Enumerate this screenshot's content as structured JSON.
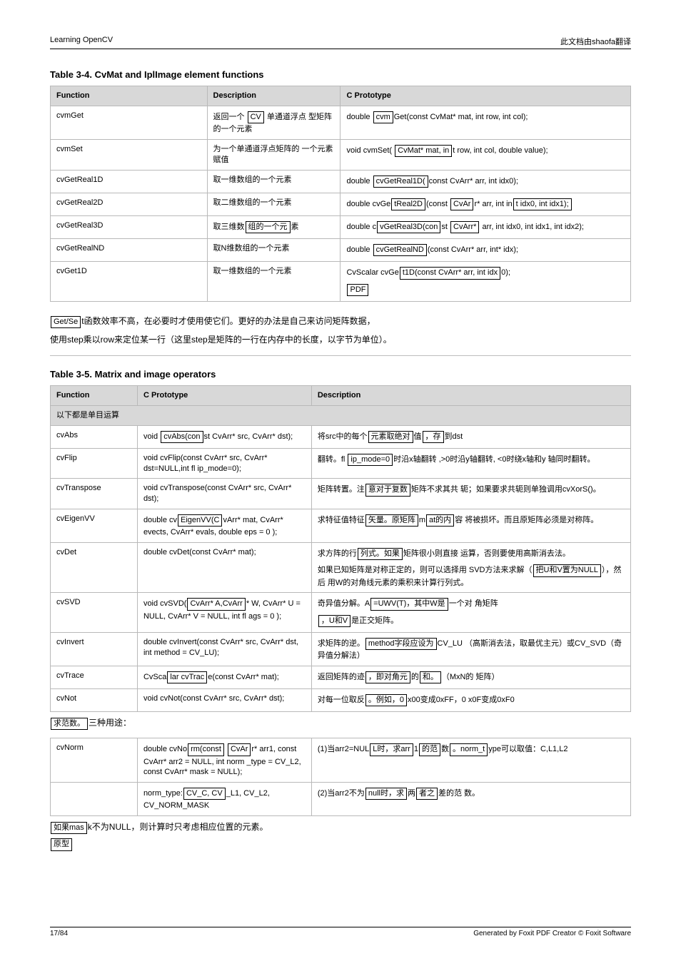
{
  "header": {
    "left": "Learning OpenCV",
    "right": "此文档由shaofa翻译"
  },
  "sections": {
    "table1_title": "Table 3-4. CvMat and IplImage element functions",
    "table1": {
      "headers": [
        "Function",
        "Description",
        "C Prototype"
      ],
      "rows": [
        {
          "func": "cvmGet",
          "desc_pre": "返回一个 ",
          "desc_box": "CV",
          "desc_post": " 单通道浮点 型矩阵的一个元素",
          "proto": [
            {
              "pre": "double ",
              "box": "cvm",
              "post": "Get(const CvMat* mat, int row, int col);"
            }
          ]
        },
        {
          "func": "cvmSet",
          "desc": "为一个单通道浮点矩阵的 一个元素赋值",
          "proto": [
            {
              "pre": "void cvmSet( ",
              "box": "CvMat* mat, in",
              "post": "t row, int col, double value);"
            }
          ]
        },
        {
          "func": "cvGetReal1D",
          "desc": "取一维数组的一个元素",
          "proto": [
            {
              "pre": "double ",
              "box": "cvGetReal1D(",
              "post": "const CvArr* arr, int idx0);"
            }
          ]
        },
        {
          "func": "cvGetReal2D",
          "desc": "取二维数组的一个元素",
          "proto": [
            {
              "pre": "double cvGe",
              "box1": "tReal2D",
              "mid": "(const ",
              "box2": "CvAr",
              "post": "r* arr, int in",
              "box3": "t idx0, int idx1);"
            }
          ]
        },
        {
          "func": "cvGetReal3D",
          "desc_pre": "取三维数",
          "desc_box": "组的一个元",
          "desc_post": "素",
          "proto": [
            {
              "pre": "double c",
              "box1": "vGetReal3D(con",
              "mid": "st ",
              "box2": "CvArr*",
              "post": " arr, int idx0, int idx1, int idx2);"
            }
          ]
        },
        {
          "func": "cvGetRealND",
          "desc": "取N维数组的一个元素",
          "proto": [
            {
              "pre": "double ",
              "box": "cvGetRealND",
              "post": "(const CvArr* arr, int* idx);"
            }
          ]
        },
        {
          "func": "cvGet1D",
          "desc": "取一维数组的一个元素",
          "proto": [
            {
              "pre": "CvScalar cvGe",
              "box1": "t1D(const CvArr* arr, int idx",
              "post": "0);",
              "box2": "PDF"
            }
          ]
        }
      ]
    },
    "note_pre": "",
    "note_box": "Get/Se",
    "note_post": "t函数效率不高，在必要时才使用使它们。更好的办法是自己来访问矩阵数据，",
    "note_line2": "使用step乘以row来定位某一行（这里step是矩阵的一行在内存中的长度，以字节为单位）。",
    "table2_title": "Table 3-5. Matrix and image operators",
    "table2": {
      "headers": [
        "Function",
        "C Prototype",
        "Description"
      ],
      "intro": "以下都是单目运算",
      "rows": [
        {
          "func": "cvAbs",
          "proto_pre": "void ",
          "proto_box": "cvAbs(con",
          "proto_post": "st CvArr* src, CvArr* dst);",
          "desc_pre": "将src中的每个",
          "desc_box1": "元素取绝对",
          "desc_mid": "值",
          "desc_box2": "，存",
          "desc_post": "到dst"
        },
        {
          "func": "cvFlip",
          "proto": "void cvFlip(const CvArr* src, CvArr* dst=NULL,int fl ip_mode=0);",
          "desc_pre": "翻转。fl ",
          "desc_box": "ip_mode=0",
          "desc_post": "时沿x轴翻转 ,>0时沿y轴翻转, <0时绕x轴和y 轴同时翻转。"
        },
        {
          "func": "cvTranspose",
          "proto": "void cvTranspose(const CvArr* src, CvArr* dst);",
          "desc_pre": "矩阵转置。注",
          "desc_box": "意对于复数",
          "desc_post": "矩阵不求其共 轭；如果要求共轭则单独调用cvXorS()。"
        },
        {
          "func": "cvEigenVV",
          "proto_pre": "double cv",
          "proto_box": "EigenVV(C",
          "proto_post": "vArr* mat, CvArr* evects, CvArr* evals, double eps = 0 );",
          "desc_pre": "求特征值特征",
          "desc_box1": "矢量。原矩阵",
          "desc_mid": "m",
          "desc_box2": "at的内",
          "desc_post": "容 将被损坏。而且原矩阵必须是对称阵。"
        },
        {
          "func": "cvDet",
          "proto": "double cvDet(const CvArr* mat);",
          "desc_pre": "求方阵的行",
          "desc_box": "列式。如果",
          "desc_post": "矩阵很小则直接 运算，否则要使用高斯消去法。",
          "desc_line2_pre": "如果已知矩阵是对称正定的，则可以选择用 SVD方法来求解（",
          "desc_line2_box": "把U和V置为NULL",
          "desc_post2": "），然后 用W的对角线元素的乘积来计算行列式。"
        },
        {
          "func": "cvSVD",
          "proto_pre": "void cvSVD(",
          "proto_box": "CvArr* A,CvArr",
          "proto_post": "* W, CvArr* U = NULL, CvArr* V = NULL, int fl ags = 0 );",
          "desc_pre": "奇异值分解。A",
          "desc_box": "=UWV(T)，其中W是",
          "desc_post": "一个对 角矩阵",
          "desc_box2": "，U和V",
          "desc_post2": "是正交矩阵。"
        },
        {
          "func": "cvInvert",
          "proto": "double cvInvert(const CvArr* src, CvArr* dst, int method = CV_LU);",
          "desc_pre": "求矩阵的逆。",
          "desc_box": "method字段应设为",
          "desc_post": "CV_LU （高斯消去法，取最优主元）或CV_SVD（奇 异值分解法）"
        },
        {
          "func": "cvTrace",
          "proto_pre": "CvSca",
          "proto_box": "lar cvTrac",
          "proto_post": "e(const CvArr* mat);",
          "desc_pre": "返回矩阵的迹",
          "desc_box1": "，即对角元",
          "desc_mid": "的",
          "desc_box2": "和。",
          "desc_post": "（MxN的 矩阵）"
        },
        {
          "func": "cvNot",
          "proto": "void cvNot(const CvArr* src, CvArr* dst);",
          "desc_pre": "对每一位取反",
          "desc_box": "。例如，0",
          "desc_post": "x00变成0xFF，0 x0F变成0xF0"
        }
      ]
    },
    "table3": {
      "intro_box": "求范数。",
      "intro_post": "三种用途：",
      "rows": [
        {
          "func": "cvNorm",
          "proto_pre": "double cvNo",
          "proto_box1": "rm(const",
          "proto_mid": " ",
          "proto_box2": "CvAr",
          "proto_post": "r* arr1, const CvArr* arr2 = NULL, int norm _type = CV_L2, const CvArr* mask = NULL);",
          "desc_pre": "(1)当arr2=NUL",
          "desc_box1": "L时，求arr",
          "desc_mid": "1",
          "desc_box2": "的范",
          "desc_post": "数",
          "desc_box3": "。norm_t",
          "desc_post2": "ype可以取值：C,L1,L2"
        },
        {
          "func": "",
          "proto_pre": "norm_type:",
          "proto_box": "CV_C, CV",
          "proto_post": "_L1, CV_L2, CV_NORM_MASK",
          "desc_pre": "(2)当arr2不为",
          "desc_box1": "null时，求",
          "desc_mid": "两",
          "desc_box2": "者之",
          "desc_post": "差的范 数。"
        }
      ],
      "after_pre": "",
      "after_box1": "如果mas",
      "after_mid": "k不为NULL，则计算时只考虑相应位置的元素。",
      "after_box2": "原型"
    }
  },
  "footer": {
    "left": "17/84",
    "right": "Generated by Foxit PDF Creator © Foxit Software"
  }
}
